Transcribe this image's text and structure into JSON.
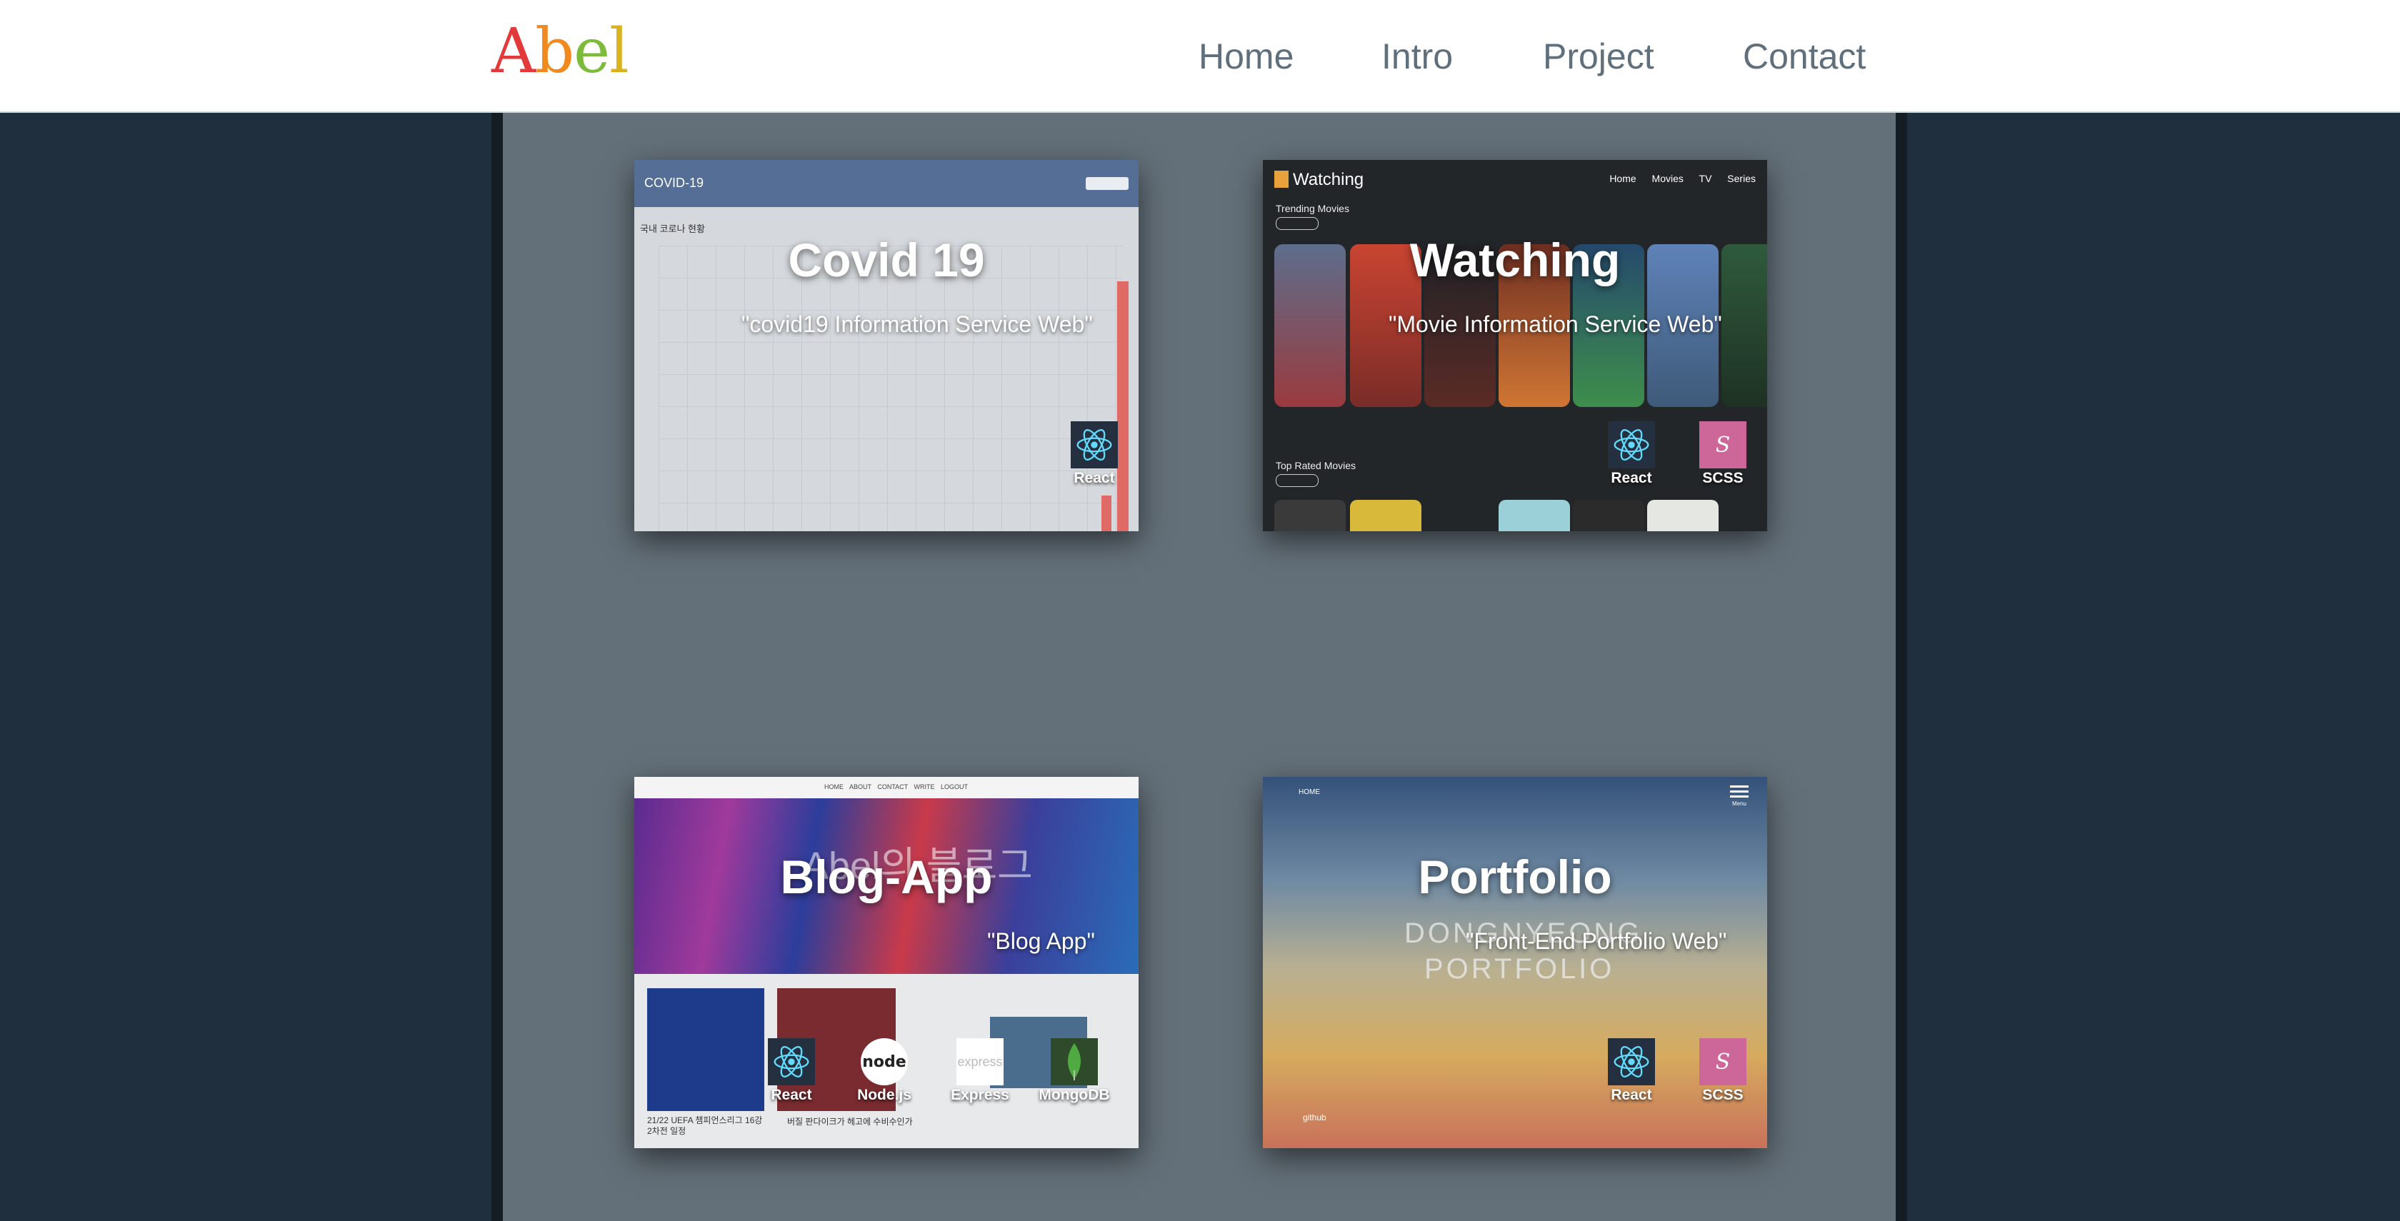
{
  "header": {
    "logo_letters": [
      "A",
      "b",
      "e",
      "l"
    ],
    "nav": [
      "Home",
      "Intro",
      "Project",
      "Contact"
    ]
  },
  "projects": [
    {
      "title": "Covid 19",
      "description": "\"covid19 Information Service Web\"",
      "tech": [
        "React"
      ],
      "preview": {
        "bar_title": "COVID-19",
        "sub": "국내 코로나 현황"
      }
    },
    {
      "title": "Watching",
      "description": "\"Movie Information Service Web\"",
      "tech": [
        "React",
        "SCSS"
      ],
      "preview": {
        "logo": "Watching",
        "nav": "Home Movies TV Series",
        "trending": "Trending Movies",
        "top_rated": "Top Rated Movies"
      }
    },
    {
      "title": "Blog-App",
      "description": "\"Blog App\"",
      "tech": [
        "React",
        "Node.js",
        "Express",
        "MongoDB"
      ],
      "preview": {
        "nav": "HOME ABOUT CONTACT WRITE LOGOUT",
        "hero_text": "Abel의 블로그",
        "caption1": "21/22 UEFA 챔피언스리그 16강 2차전 일정",
        "caption2": "버질 판다이크가 헤고에 수비수인가"
      }
    },
    {
      "title": "Portfolio",
      "description": "\"Front-End Portfolio Web\"",
      "tech": [
        "React",
        "SCSS"
      ],
      "preview": {
        "home": "HOME",
        "menu": "Menu",
        "big_line1": "DONGNYEONG",
        "big_line2": "PORTFOLIO",
        "github": "github"
      }
    }
  ]
}
